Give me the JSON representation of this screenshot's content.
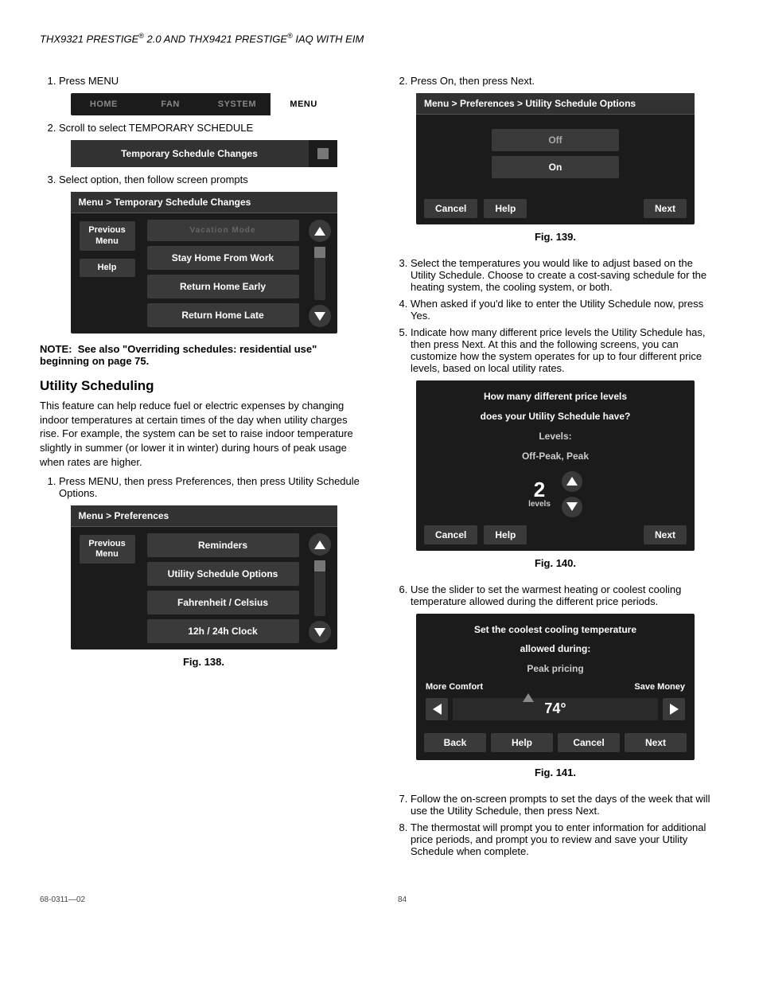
{
  "header": {
    "model1": "THX9321 PRESTIGE",
    "ver": "2.0 AND THX9421 PRESTIGE",
    "tail": "IAQ WITH EIM"
  },
  "left": {
    "step1": "Press MENU",
    "tabs": {
      "home": "HOME",
      "fan": "FAN",
      "system": "SYSTEM",
      "menu": "MENU"
    },
    "step2": "Scroll to select TEMPORARY SCHEDULE",
    "strip_label": "Temporary Schedule Changes",
    "step3": "Select option, then follow screen prompts",
    "panel3": {
      "hdr": "Menu > Temporary Schedule Changes",
      "prev": "Previous Menu",
      "help": "Help",
      "items": {
        "faded": "Vacation Mode",
        "i1": "Stay Home From Work",
        "i2": "Return Home Early",
        "i3": "Return Home Late"
      }
    },
    "note_label": "NOTE:",
    "note": "See also \"Overriding schedules: residential use\" beginning on page 75.",
    "h3": "Utility Scheduling",
    "para": "This feature can help reduce fuel or electric expenses by changing indoor temperatures at certain times of the day when utility charges rise. For example, the system can be set to raise indoor temperature slightly in summer (or lower it in winter) during hours of peak usage when rates are higher.",
    "step_util1": "Press MENU, then press Preferences, then press Utility Schedule Options.",
    "panel4": {
      "hdr": "Menu > Preferences",
      "prev": "Previous Menu",
      "items": {
        "i1": "Reminders",
        "i2": "Utility Schedule Options",
        "i3": "Fahrenheit / Celsius",
        "i4": "12h / 24h Clock"
      }
    },
    "fig138": "Fig. 138."
  },
  "right": {
    "step2": "Press On, then press Next.",
    "panel5": {
      "hdr": "Menu > Preferences > Utility Schedule Options",
      "off": "Off",
      "on": "On",
      "cancel": "Cancel",
      "help": "Help",
      "next": "Next"
    },
    "fig139": "Fig. 139.",
    "step3": "Select the temperatures you would like to adjust based on the Utility Schedule. Choose to create a cost-saving schedule for the heating system, the cooling system, or both.",
    "step4": "When asked if you'd like to enter the Utility Schedule now, press Yes.",
    "step5": "Indicate how many different price levels the Utility Schedule has, then press Next. At this and the following screens, you can customize how the system operates for up to four different price levels, based on local utility rates.",
    "panel6": {
      "q1": "How many different price levels",
      "q2": "does your Utility Schedule have?",
      "lv": "Levels:",
      "opts": "Off-Peak, Peak",
      "num": "2",
      "unit": "levels",
      "cancel": "Cancel",
      "help": "Help",
      "next": "Next"
    },
    "fig140": "Fig. 140.",
    "step6": "Use the slider to set the warmest heating or coolest cooling temperature allowed during the different price periods.",
    "panel7": {
      "t1": "Set the coolest cooling temperature",
      "t2": "allowed during:",
      "mode": "Peak pricing",
      "left": "More Comfort",
      "right": "Save Money",
      "val": "74°",
      "back": "Back",
      "help": "Help",
      "cancel": "Cancel",
      "next": "Next"
    },
    "fig141": "Fig. 141.",
    "step7": "Follow the on-screen prompts to set the days of the week that will use the Utility Schedule, then press Next.",
    "step8": "The thermostat will prompt you to enter information for additional price periods, and prompt you to review and save your Utility Schedule when complete."
  },
  "footer": {
    "left": "68-0311—02",
    "page": "84"
  }
}
